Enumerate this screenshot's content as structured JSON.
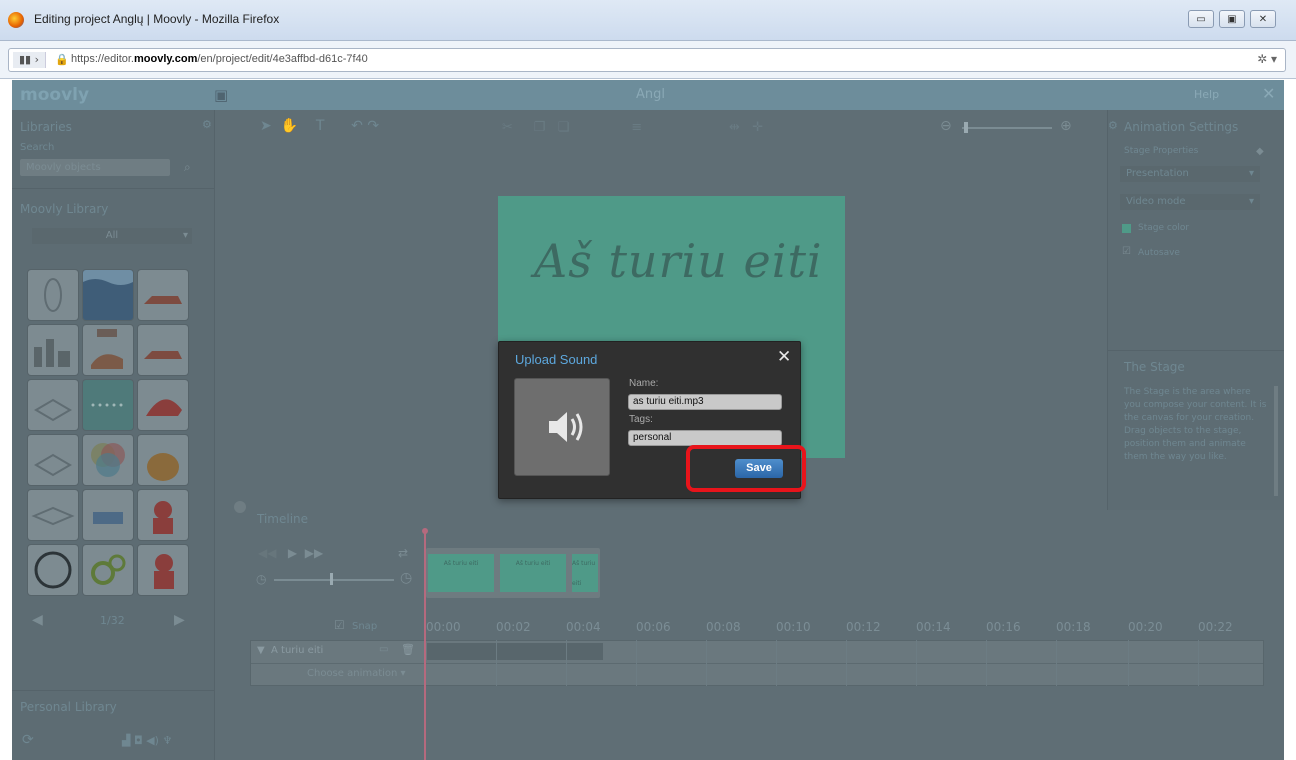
{
  "browser": {
    "title": "Editing project Anglų | Moovly - Mozilla Firefox",
    "url_prefix": "https://editor.",
    "url_domain": "moovly.com",
    "url_suffix": "/en/project/edit/4e3affbd-d61c-7f40"
  },
  "app": {
    "logo": "moovly",
    "project_name": "Angl",
    "help_label": "Help"
  },
  "left_panel": {
    "libraries_label": "Libraries",
    "search_label": "Search",
    "search_placeholder": "Moovly objects",
    "moovly_library_label": "Moovly Library",
    "category_selected": "All",
    "pagination": "1/32",
    "personal_library_label": "Personal Library"
  },
  "right_panel": {
    "title": "Animation Settings",
    "stage_properties_label": "Stage Properties",
    "presentation_option": "Presentation",
    "video_mode_option": "Video mode",
    "stage_color_label": "Stage color",
    "autosave_label": "Autosave",
    "autosave_checked": true,
    "stage_help_title": "The Stage",
    "stage_help_text": "The Stage is the area where you compose your content. It is the canvas for your creation. Drag objects to the stage, position them and animate them the way you like."
  },
  "stage": {
    "text": "Aš turiu eiti",
    "color": "#4f9a88"
  },
  "timeline": {
    "title": "Timeline",
    "snap_label": "Snap",
    "ticks": [
      "00:00",
      "00:02",
      "00:04",
      "00:06",
      "00:08",
      "00:10",
      "00:12",
      "00:14",
      "00:16",
      "00:18",
      "00:20",
      "00:22"
    ],
    "thumb_label": "Aš turiu eiti",
    "track_name": "A turiu eiti",
    "choose_animation": "Choose animation"
  },
  "modal": {
    "title": "Upload Sound",
    "name_label": "Name:",
    "name_value": "as turiu eiti.mp3",
    "tags_label": "Tags:",
    "tags_value": "personal",
    "save_label": "Save",
    "icon": "speaker-icon"
  },
  "colors": {
    "accent": "#5da8de",
    "highlight": "#e8141b",
    "overlay": "#5f6e75"
  }
}
